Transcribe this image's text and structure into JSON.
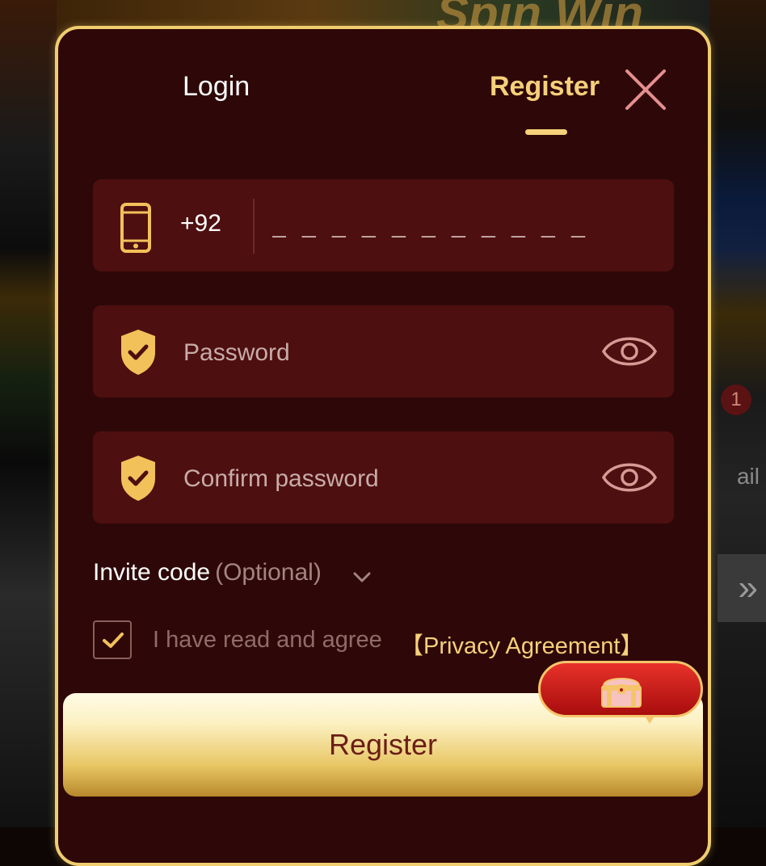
{
  "tabs": {
    "login": "Login",
    "register": "Register"
  },
  "phone": {
    "country_code": "+92",
    "placeholder": "_ _ _ _ _ _ _ _ _ _ _"
  },
  "password": {
    "placeholder": "Password"
  },
  "confirm_password": {
    "placeholder": "Confirm password"
  },
  "invite": {
    "label": "Invite code",
    "optional": "(Optional)"
  },
  "agreement": {
    "text": "I have read and agree",
    "link": "【Privacy Agreement】",
    "checked": true
  },
  "register_button": "Register",
  "background": {
    "title": "Spin Win",
    "badge": "1",
    "side_text": "ail"
  },
  "colors": {
    "accent_gold": "#f6d07a",
    "panel": "#2e0808",
    "field": "#4e0f10",
    "close_pink": "#e58f8f"
  },
  "icons": [
    "phone-icon",
    "shield-check-icon",
    "eye-icon",
    "close-icon",
    "chevron-down-icon",
    "checkmark-icon",
    "treasure-chest-icon"
  ]
}
